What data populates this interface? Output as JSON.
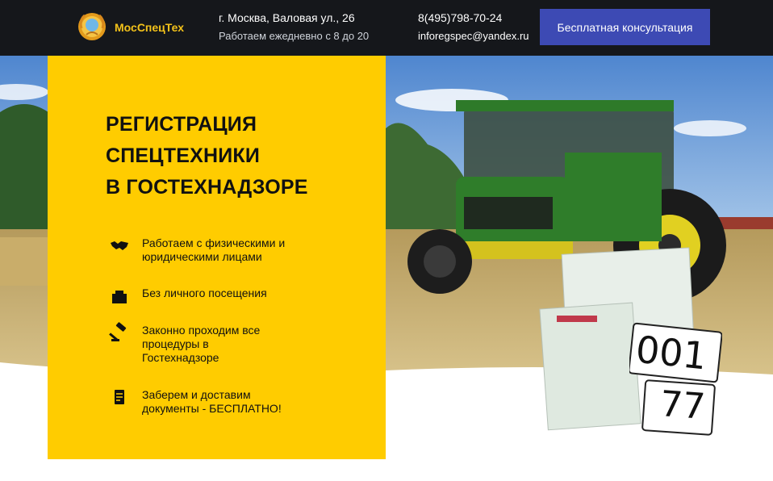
{
  "header": {
    "brand": "МосСпецТех",
    "address": "г. Москва, Валовая ул., 26",
    "hours": "Работаем ежедневно с 8 до 20",
    "phone": "8(495)798-70-24",
    "email": "inforegspec@yandex.ru",
    "cta_label": "Бесплатная консультация"
  },
  "hero": {
    "title_lines": [
      "РЕГИСТРАЦИЯ",
      "СПЕЦТЕХНИКИ",
      "В ГОСТЕХНАДЗОРЕ"
    ],
    "features": [
      {
        "icon": "handshake-icon",
        "text": "Работаем с физическими и\nюридическими лицами"
      },
      {
        "icon": "building-icon",
        "text": "Без личного посещения"
      },
      {
        "icon": "gavel-icon",
        "text": "Законно проходим все\nпроцедуры в\nГостехнадзоре"
      },
      {
        "icon": "document-icon",
        "text": "Заберем и доставим\nдокументы - БЕСПЛАТНО!"
      }
    ],
    "plate_number": "001",
    "plate_region": "77"
  },
  "colors": {
    "header_bg": "#15171b",
    "brand_yellow": "#f3c21a",
    "card_yellow": "#ffcc00",
    "cta_blue": "#3d4ab4",
    "tractor_green": "#2f7d2a"
  }
}
